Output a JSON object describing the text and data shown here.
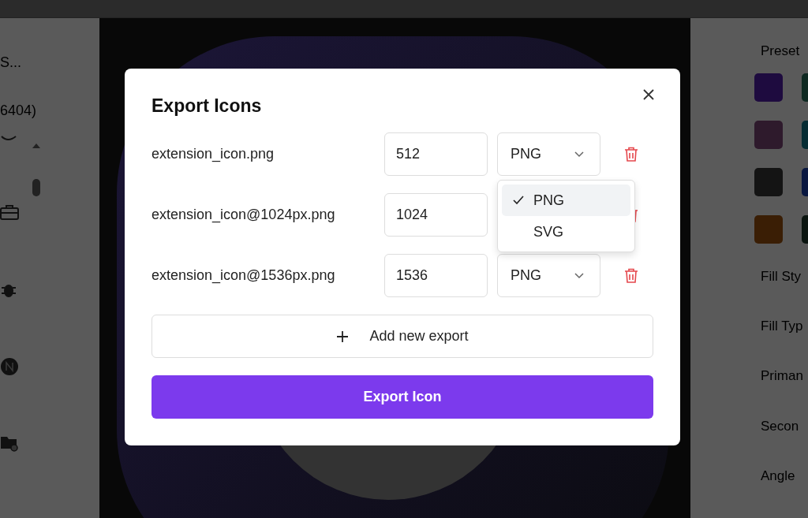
{
  "left_panel": {
    "title": "S...",
    "count": "6404)"
  },
  "right_panel": {
    "heading": "Preset",
    "swatches": [
      {
        "color": "#1e0b3f"
      },
      {
        "color": "#0f2a22"
      },
      {
        "color": "#2e1a2c"
      },
      {
        "color": "#062c33"
      },
      {
        "color": "#141414"
      },
      {
        "color": "#0a1840"
      },
      {
        "color": "#3a1e05"
      },
      {
        "color": "#0b1510"
      }
    ],
    "labels": [
      "Fill Sty",
      "Fill Typ",
      "Priman",
      "Secon",
      "Angle"
    ]
  },
  "dialog": {
    "title": "Export Icons",
    "rows": [
      {
        "name": "extension_icon.png",
        "size": "512",
        "format": "PNG"
      },
      {
        "name": "extension_icon@1024px.png",
        "size": "1024"
      },
      {
        "name": "extension_icon@1536px.png",
        "size": "1536",
        "format": "PNG"
      }
    ],
    "format_menu": [
      {
        "label": "PNG",
        "selected": true
      },
      {
        "label": "SVG",
        "selected": false
      }
    ],
    "add_button": "Add new export",
    "export_button": "Export Icon"
  }
}
